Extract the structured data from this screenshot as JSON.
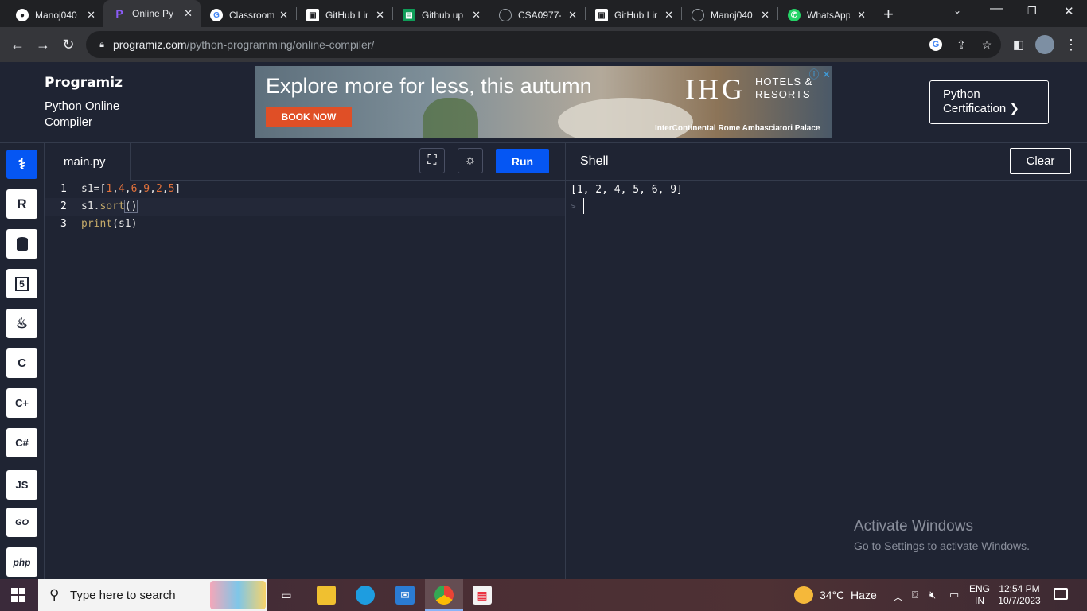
{
  "browser": {
    "tabs": [
      {
        "title": "Manoj040",
        "favicon": "github-icon",
        "active": false
      },
      {
        "title": "Online Pyt",
        "favicon": "programiz-icon",
        "active": true
      },
      {
        "title": "Classroom",
        "favicon": "google-icon",
        "active": false
      },
      {
        "title": "GitHub Lin",
        "favicon": "image-icon",
        "active": false
      },
      {
        "title": "Github up",
        "favicon": "sheets-icon",
        "active": false
      },
      {
        "title": "CSA0977-",
        "favicon": "github-icon",
        "active": false
      },
      {
        "title": "GitHub Lin",
        "favicon": "image-icon",
        "active": false
      },
      {
        "title": "Manoj040",
        "favicon": "github-icon",
        "active": false
      },
      {
        "title": "WhatsApp",
        "favicon": "whatsapp-icon",
        "active": false
      }
    ],
    "url_host": "programiz.com",
    "url_path": "/python-programming/online-compiler/"
  },
  "site": {
    "logo": "Programiz",
    "subtitle": "Python Online Compiler",
    "cert_button": "Python Certification ❯"
  },
  "ad": {
    "headline": "Explore more for less, this autumn",
    "button": "BOOK NOW",
    "brand": "IHG",
    "brand_sub_1": "HOTELS &",
    "brand_sub_2": "RESORTS",
    "caption": "InterContinental Rome Ambasciatori Palace"
  },
  "rail": {
    "items": [
      {
        "name": "python",
        "label": "",
        "icon": "python-icon",
        "active": true
      },
      {
        "name": "r",
        "label": "R",
        "icon": "r-icon",
        "active": false
      },
      {
        "name": "sql",
        "label": "",
        "icon": "database-icon",
        "active": false
      },
      {
        "name": "html",
        "label": "5",
        "icon": "html5-icon",
        "active": false
      },
      {
        "name": "java",
        "label": "♨",
        "icon": "java-icon",
        "active": false
      },
      {
        "name": "c",
        "label": "C",
        "icon": "c-icon",
        "active": false
      },
      {
        "name": "cpp",
        "label": "C+",
        "icon": "cpp-icon",
        "active": false
      },
      {
        "name": "csharp",
        "label": "C#",
        "icon": "csharp-icon",
        "active": false
      },
      {
        "name": "js",
        "label": "JS",
        "icon": "js-icon",
        "active": false
      },
      {
        "name": "go",
        "label": "GO",
        "icon": "go-icon",
        "active": false
      },
      {
        "name": "php",
        "label": "php",
        "icon": "php-icon",
        "active": false
      }
    ]
  },
  "editor": {
    "filename": "main.py",
    "run_label": "Run",
    "lines": [
      {
        "num": "1",
        "text": "s1=[1,4,6,9,2,5]"
      },
      {
        "num": "2",
        "text": "s1.sort()"
      },
      {
        "num": "3",
        "text": "print(s1)"
      }
    ]
  },
  "shell": {
    "title": "Shell",
    "clear_label": "Clear",
    "output": "[1, 2, 4, 5, 6, 9]",
    "prompt": ">"
  },
  "watermark": {
    "title": "Activate Windows",
    "subtitle": "Go to Settings to activate Windows."
  },
  "taskbar": {
    "search_placeholder": "Type here to search",
    "weather": "34°C  Haze",
    "lang_1": "ENG",
    "lang_2": "IN",
    "time": "12:54 PM",
    "date": "10/7/2023"
  },
  "colors": {
    "accent": "#0556f3",
    "background": "#1f2433",
    "number": "#e2723b",
    "function": "#c3a969"
  }
}
